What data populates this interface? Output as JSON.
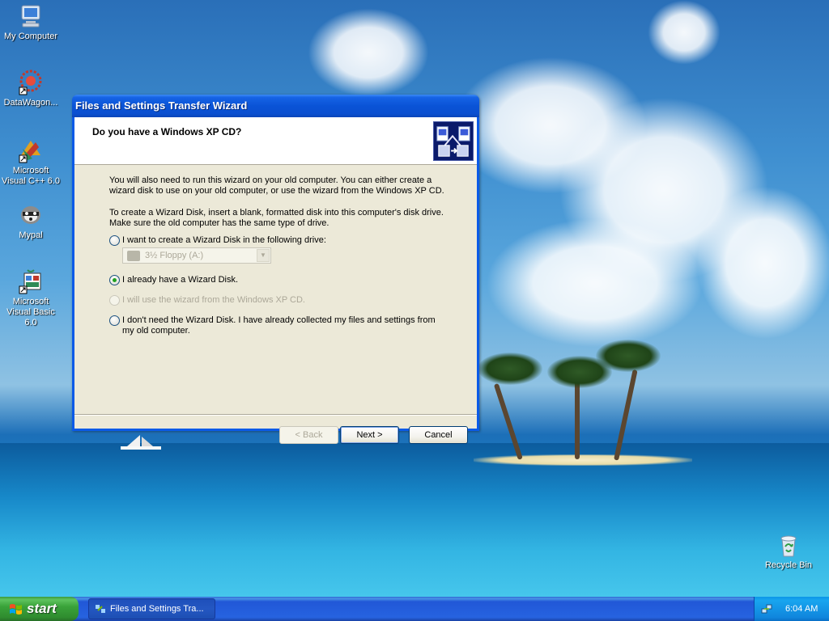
{
  "desktop": {
    "icons": [
      {
        "label": "My Computer",
        "icon": "my-computer-icon"
      },
      {
        "label": "DataWagon...",
        "icon": "datawagon-icon"
      },
      {
        "label": "Microsoft Visual C++ 6.0",
        "icon": "visual-cpp-icon"
      },
      {
        "label": "Mypal",
        "icon": "mypal-icon"
      },
      {
        "label": "Microsoft Visual Basic 6.0",
        "icon": "visual-basic-icon"
      },
      {
        "label": "Recycle Bin",
        "icon": "recycle-bin-icon"
      }
    ]
  },
  "wizard": {
    "window_title": "Files and Settings Transfer Wizard",
    "header_title": "Do you have a Windows XP CD?",
    "header_icon": "transfer-wizard-icon",
    "paragraph1": "You will also need to run this wizard on your old computer. You can either create a wizard disk to use on your old computer, or use the wizard from the Windows XP CD.",
    "paragraph2": "To create a Wizard Disk, insert a blank, formatted disk into this computer's disk drive. Make sure the old computer has the same type of drive.",
    "options": [
      {
        "label": "I want to create a Wizard Disk in the following drive:",
        "checked": false,
        "enabled": true
      },
      {
        "label": "I already have a Wizard Disk.",
        "checked": true,
        "enabled": true
      },
      {
        "label": "I will use the wizard from the Windows XP CD.",
        "checked": false,
        "enabled": false
      },
      {
        "label": "I don't need the Wizard Disk. I have already collected my files and settings from my old computer.",
        "checked": false,
        "enabled": true
      }
    ],
    "drive_select": {
      "value": "3½ Floppy (A:)",
      "enabled": false
    },
    "buttons": {
      "back": "< Back",
      "next": "Next >",
      "cancel": "Cancel"
    }
  },
  "taskbar": {
    "start_label": "start",
    "task_label": "Files and Settings Tra...",
    "clock": "6:04 AM"
  },
  "colors": {
    "title_blue": "#0a53d6",
    "dialog_bg": "#ece9d8",
    "start_green": "#3aa33a",
    "taskbar_blue": "#2457c2"
  }
}
